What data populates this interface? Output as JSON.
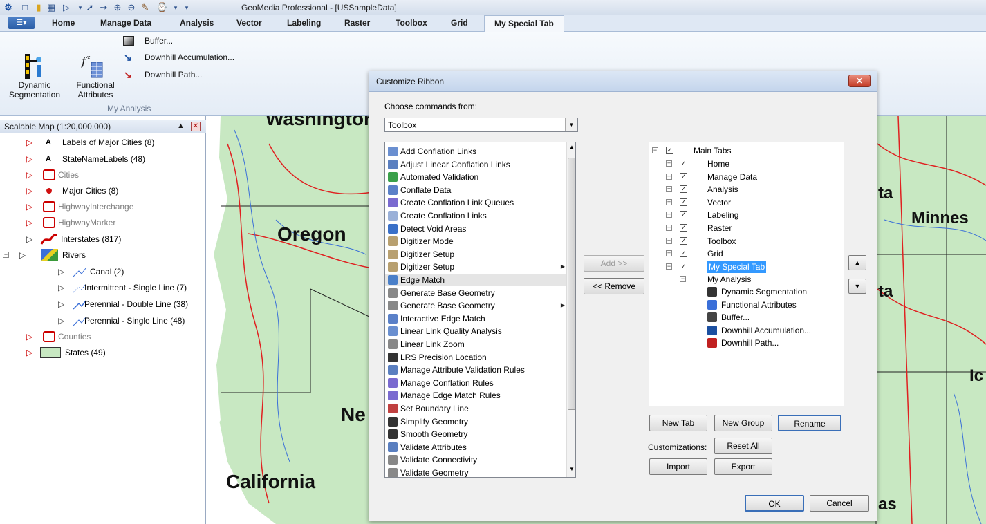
{
  "window": {
    "title": "GeoMedia Professional - [USSampleData]"
  },
  "quick_access": [
    "app-icon",
    "new-icon",
    "open-icon",
    "save-icon",
    "select-icon",
    "pan-icon",
    "fit-icon",
    "zoom-in-icon",
    "zoom-out-icon",
    "style-icon",
    "refresh-icon",
    "dropdown-icon"
  ],
  "tabs": [
    "Home",
    "Manage Data",
    "Analysis",
    "Vector",
    "Labeling",
    "Raster",
    "Toolbox",
    "Grid",
    "My Special Tab"
  ],
  "ribbon": {
    "dynamic_segmentation": "Dynamic\nSegmentation",
    "functional_attributes": "Functional\nAttributes",
    "buffer": "Buffer...",
    "downhill_accumulation": "Downhill Accumulation...",
    "downhill_path": "Downhill Path...",
    "group_label": "My Analysis"
  },
  "legend": {
    "title": "Scalable Map (1:20,000,000)",
    "items": [
      {
        "label": "Labels of Major Cities (8)",
        "grey": false
      },
      {
        "label": "StateNameLabels (48)",
        "grey": false
      },
      {
        "label": "Cities",
        "grey": true
      },
      {
        "label": "Major Cities (8)",
        "grey": false
      },
      {
        "label": "HighwayInterchange",
        "grey": true
      },
      {
        "label": "HighwayMarker",
        "grey": true
      },
      {
        "label": "Interstates (817)",
        "grey": false
      },
      {
        "label": "Rivers",
        "grey": false
      },
      {
        "label": "Canal (2)",
        "grey": false
      },
      {
        "label": "Intermittent - Single Line (7)",
        "grey": false
      },
      {
        "label": "Perennial - Double Line (38)",
        "grey": false
      },
      {
        "label": "Perennial - Single Line (48)",
        "grey": false
      },
      {
        "label": "Counties",
        "grey": true
      },
      {
        "label": "States (49)",
        "grey": false
      }
    ]
  },
  "map": {
    "labels": [
      "Washington",
      "Oregon",
      "Ne",
      "California",
      "ta",
      "Minnes",
      "ta",
      "Ic",
      "as"
    ]
  },
  "dialog": {
    "title": "Customize Ribbon",
    "choose_label": "Choose commands from:",
    "choose_value": "Toolbox",
    "commands": [
      {
        "label": "Add Conflation Links",
        "arrow": false
      },
      {
        "label": "Adjust Linear Conflation Links",
        "arrow": false
      },
      {
        "label": "Automated Validation",
        "arrow": false
      },
      {
        "label": "Conflate Data",
        "arrow": false
      },
      {
        "label": "Create Conflation Link Queues",
        "arrow": false
      },
      {
        "label": "Create Conflation Links",
        "arrow": false
      },
      {
        "label": "Detect Void Areas",
        "arrow": false
      },
      {
        "label": "Digitizer Mode",
        "arrow": false
      },
      {
        "label": "Digitizer Setup",
        "arrow": false
      },
      {
        "label": "Digitizer Setup",
        "arrow": true
      },
      {
        "label": "Edge Match",
        "arrow": false
      },
      {
        "label": "Generate Base Geometry",
        "arrow": false
      },
      {
        "label": "Generate Base Geometry",
        "arrow": true
      },
      {
        "label": "Interactive Edge Match",
        "arrow": false
      },
      {
        "label": "Linear Link Quality Analysis",
        "arrow": false
      },
      {
        "label": "Linear Link Zoom",
        "arrow": false
      },
      {
        "label": "LRS Precision Location",
        "arrow": false
      },
      {
        "label": "Manage Attribute Validation Rules",
        "arrow": false
      },
      {
        "label": "Manage Conflation Rules",
        "arrow": false
      },
      {
        "label": "Manage Edge Match Rules",
        "arrow": false
      },
      {
        "label": "Set Boundary Line",
        "arrow": false
      },
      {
        "label": "Simplify Geometry",
        "arrow": false
      },
      {
        "label": "Smooth Geometry",
        "arrow": false
      },
      {
        "label": "Validate Attributes",
        "arrow": false
      },
      {
        "label": "Validate Connectivity",
        "arrow": false
      },
      {
        "label": "Validate Geometry",
        "arrow": false
      }
    ],
    "selected_command": "Edge Match",
    "add_button": "Add >>",
    "remove_button": "<< Remove",
    "tree": {
      "root": "Main Tabs",
      "tabs": [
        "Home",
        "Manage Data",
        "Analysis",
        "Vector",
        "Labeling",
        "Raster",
        "Toolbox",
        "Grid",
        "My Special Tab"
      ],
      "selected": "My Special Tab",
      "group": "My Analysis",
      "group_items": [
        "Dynamic Segmentation",
        "Functional Attributes",
        "Buffer...",
        "Downhill Accumulation...",
        "Downhill Path..."
      ]
    },
    "new_tab": "New Tab",
    "new_group": "New Group",
    "rename": "Rename",
    "customizations_label": "Customizations:",
    "reset_all": "Reset All",
    "import": "Import",
    "export": "Export",
    "ok": "OK",
    "cancel": "Cancel"
  },
  "colors": {
    "accent": "#3399ff",
    "map_land": "#c8e8c2",
    "interstate": "#e02020",
    "river": "#3a6fd8"
  }
}
